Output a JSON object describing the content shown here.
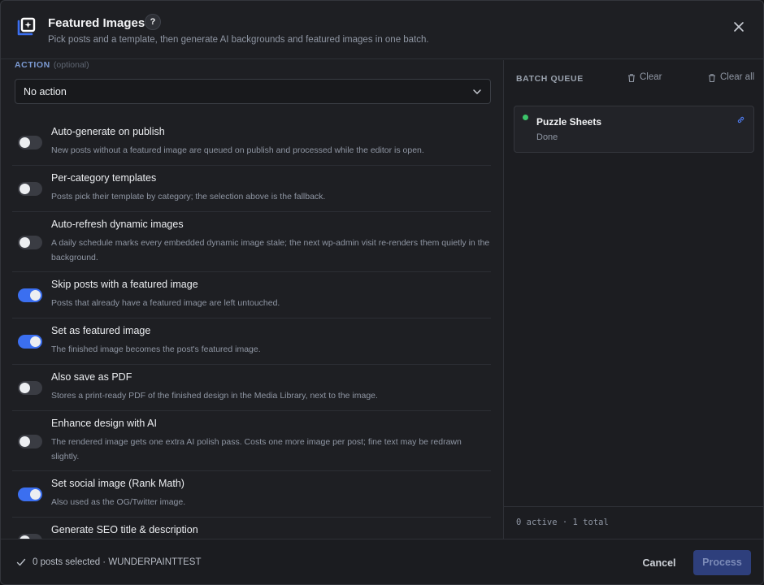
{
  "header": {
    "title": "Featured Images",
    "help_label": "?",
    "subtitle": "Pick posts and a template, then generate AI backgrounds and featured images in one batch.",
    "logo_icon": "image-sparkle-icon",
    "close_icon": "close-icon"
  },
  "action": {
    "label": "ACTION",
    "optional_label": "(optional)",
    "selected": "No action"
  },
  "options": [
    {
      "label": "Auto-generate on publish",
      "description": "New posts without a featured image are queued on publish and processed while the editor is open.",
      "enabled": false
    },
    {
      "label": "Per-category templates",
      "description": "Posts pick their template by category; the selection above is the fallback.",
      "enabled": false
    },
    {
      "label": "Auto-refresh dynamic images",
      "description": "A daily schedule marks every embedded dynamic image stale; the next wp-admin visit re-renders them quietly in the background.",
      "enabled": false
    },
    {
      "label": "Skip posts with a featured image",
      "description": "Posts that already have a featured image are left untouched.",
      "enabled": true
    },
    {
      "label": "Set as featured image",
      "description": "The finished image becomes the post's featured image.",
      "enabled": true
    },
    {
      "label": "Also save as PDF",
      "description": "Stores a print-ready PDF of the finished design in the Media Library, next to the image.",
      "enabled": false
    },
    {
      "label": "Enhance design with AI",
      "description": "The rendered image gets one extra AI polish pass. Costs one more image per post; fine text may be redrawn slightly.",
      "enabled": false
    },
    {
      "label": "Set social image (Rank Math)",
      "description": "Also used as the OG/Twitter image.",
      "enabled": true
    },
    {
      "label": "Generate SEO title & description",
      "description": "",
      "enabled": false
    }
  ],
  "queue": {
    "title": "BATCH QUEUE",
    "clear_label": "Clear",
    "clear_all_label": "Clear all",
    "items": [
      {
        "name": "Puzzle Sheets",
        "status": "Done",
        "status_color": "#3cc46a"
      }
    ],
    "stats": "0 active · 1 total"
  },
  "footer": {
    "selection": "0 posts selected · WUNDERPAINTTEST",
    "cancel_label": "Cancel",
    "process_label": "Process"
  },
  "colors": {
    "accent": "#3b6ff0",
    "success": "#3cc46a",
    "background": "#1e1f23"
  }
}
